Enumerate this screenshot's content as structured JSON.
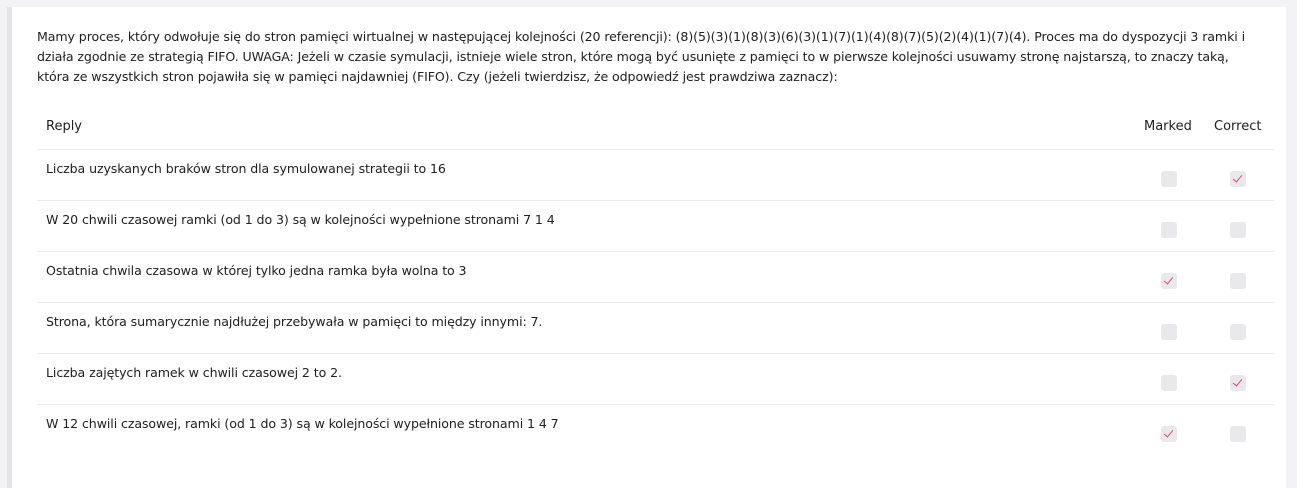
{
  "question": "Mamy proces, który odwołuje się do stron pamięci wirtualnej w następującej kolejności (20 referencji): (8)(5)(3)(1)(8)(3)(6)(3)(1)(7)(1)(4)(8)(7)(5)(2)(4)(1)(7)(4). Proces ma do dyspozycji 3 ramki i działa zgodnie ze strategią FIFO. UWAGA: Jeżeli w czasie symulacji, istnieje wiele stron, które mogą być usunięte z pamięci to w pierwsze kolejności usuwamy stronę najstarszą, to znaczy taką, która ze wszystkich stron pojawiła się w pamięci najdawniej (FIFO). Czy (jeżeli twierdzisz, że odpowiedź jest prawdziwa zaznacz):",
  "table": {
    "headers": {
      "reply": "Reply",
      "marked": "Marked",
      "correct": "Correct"
    },
    "rows": [
      {
        "reply": "Liczba uzyskanych braków stron dla symulowanej strategii to 16",
        "marked": false,
        "correct": true
      },
      {
        "reply": "W 20 chwili czasowej ramki (od 1 do 3) są w kolejności  wypełnione stronami 7 1 4",
        "marked": false,
        "correct": false
      },
      {
        "reply": "Ostatnia chwila czasowa w której tylko jedna ramka była wolna to  3",
        "marked": true,
        "correct": false
      },
      {
        "reply": "Strona, która sumarycznie najdłużej przebywała w pamięci to między innymi: 7.",
        "marked": false,
        "correct": false
      },
      {
        "reply": "Liczba zajętych ramek w chwili czasowej 2 to 2.",
        "marked": false,
        "correct": true
      },
      {
        "reply": "W 12 chwili czasowej, ramki (od 1 do 3) są w kolejności wypełnione stronami 1 4 7",
        "marked": true,
        "correct": false
      }
    ]
  },
  "colors": {
    "check": "#e4447a",
    "checkbox_bg": "#e9e9ec"
  }
}
